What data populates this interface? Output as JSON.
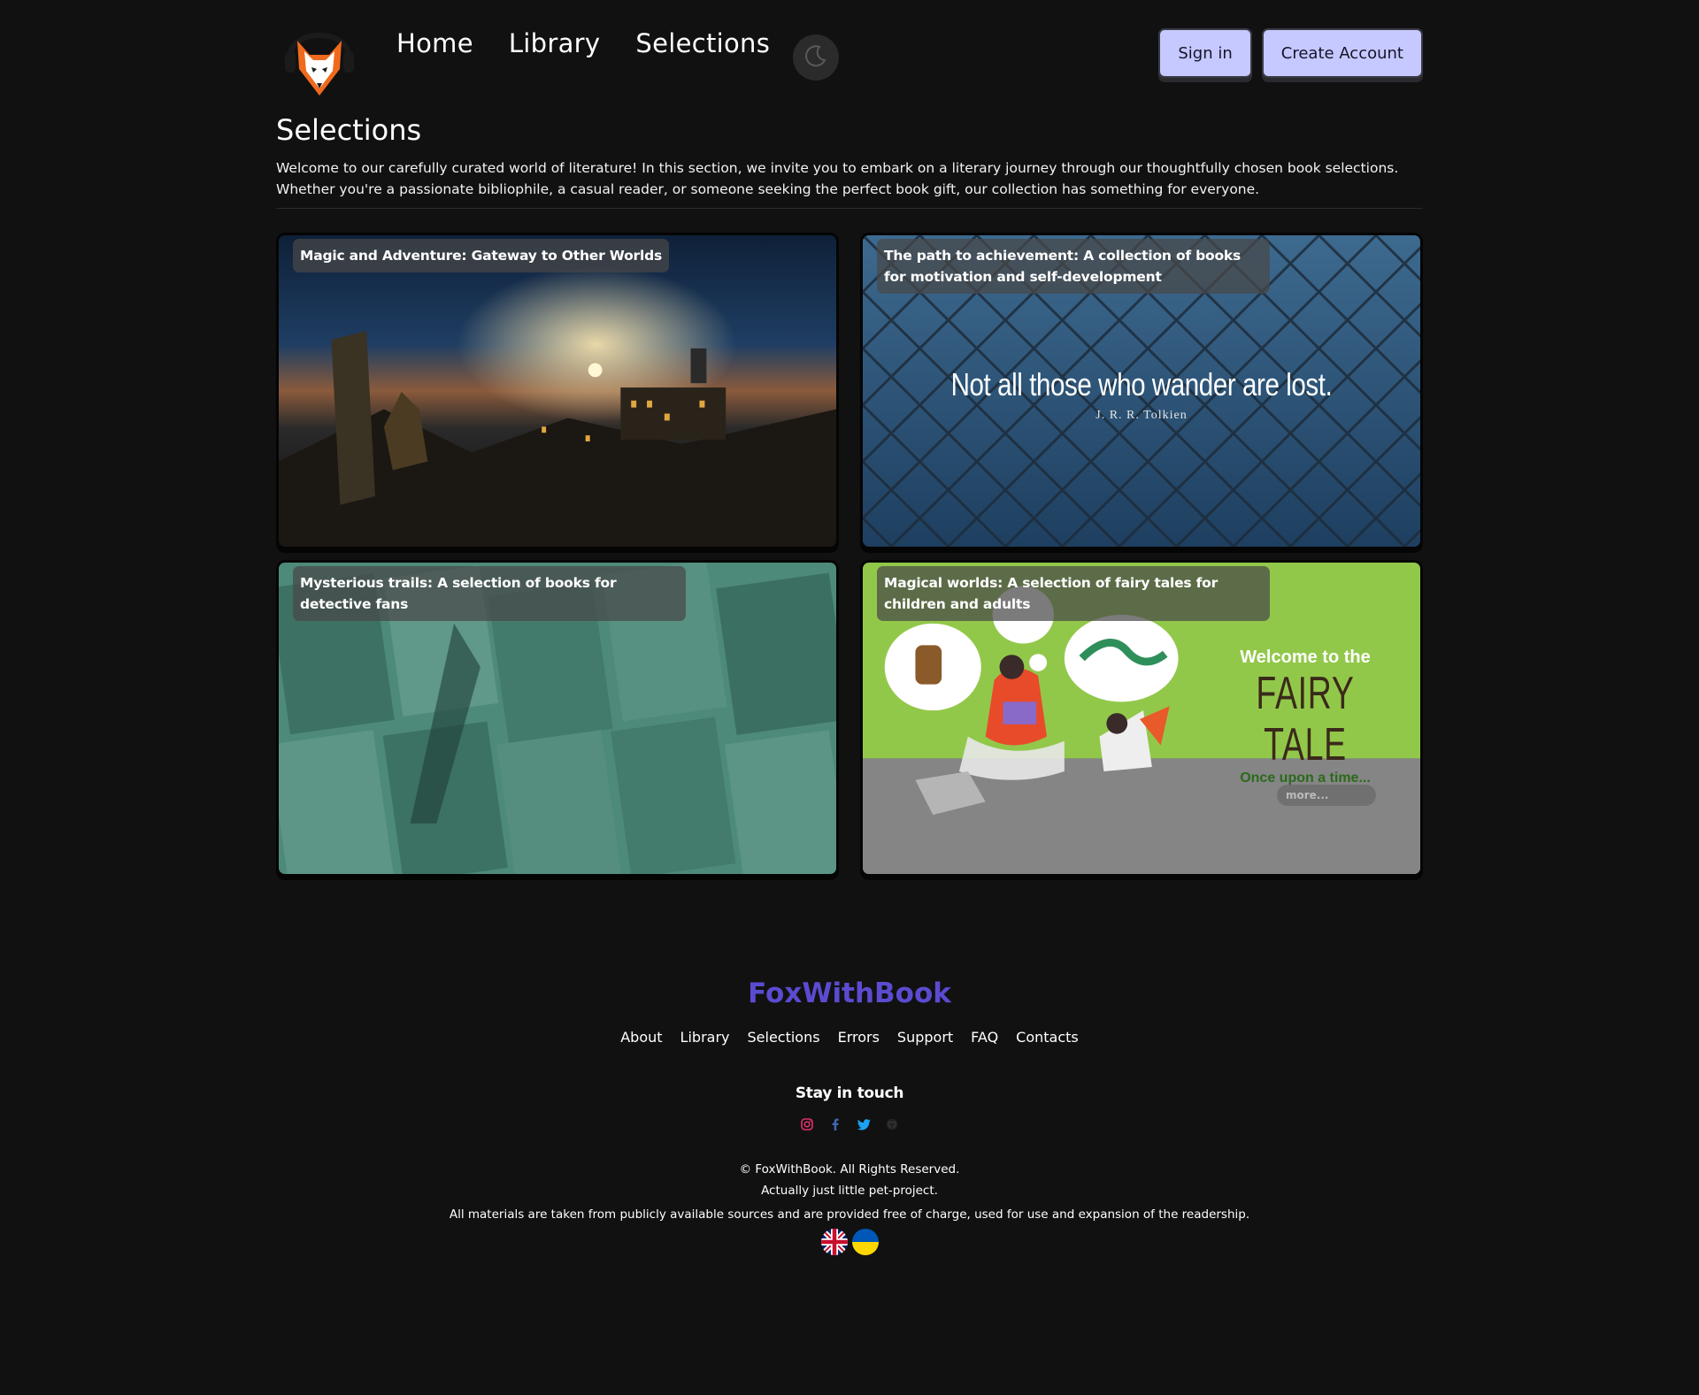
{
  "nav": {
    "links": [
      "Home",
      "Library",
      "Selections"
    ],
    "theme_icon": "moon-icon",
    "sign_in": "Sign in",
    "create_account": "Create Account"
  },
  "intro": {
    "title": "Selections",
    "description": "Welcome to our carefully curated world of literature! In this section, we invite you to embark on a literary journey through our thoughtfully chosen book selections. Whether you're a passionate bibliophile, a casual reader, or someone seeking the perfect book gift, our collection has something for everyone."
  },
  "cards": [
    {
      "title": "Magic and Adventure: Gateway to Other Worlds"
    },
    {
      "title": "The path to achievement: A collection of books for motivation and self-development",
      "quote": "Not all those who wander are lost.",
      "author": "J. R. R. Tolkien"
    },
    {
      "title": "Mysterious trails: A selection of books for detective fans"
    },
    {
      "title": "Magical worlds: A selection of fairy tales for children and adults",
      "welcome": "Welcome to the",
      "big": "FAIRY TALE",
      "sub": "Once upon a time...",
      "more": "more..."
    }
  ],
  "footer": {
    "brand": "FoxWithBook",
    "links": [
      "About",
      "Library",
      "Selections",
      "Errors",
      "Support",
      "FAQ",
      "Contacts"
    ],
    "stay": "Stay in touch",
    "socials": [
      "instagram-icon",
      "facebook-icon",
      "twitter-icon",
      "github-icon"
    ],
    "copyright": "© FoxWithBook. All Rights Reserved.",
    "pet": "Actually just little pet-project.",
    "note": "All materials are taken from publicly available sources and are provided free of charge, used for use and expansion of the readership.",
    "languages": [
      "uk-flag-icon",
      "ukraine-flag-icon"
    ]
  },
  "colors": {
    "background": "#111111",
    "button": "#c6c9ff",
    "brand": "#5a4bd0"
  }
}
